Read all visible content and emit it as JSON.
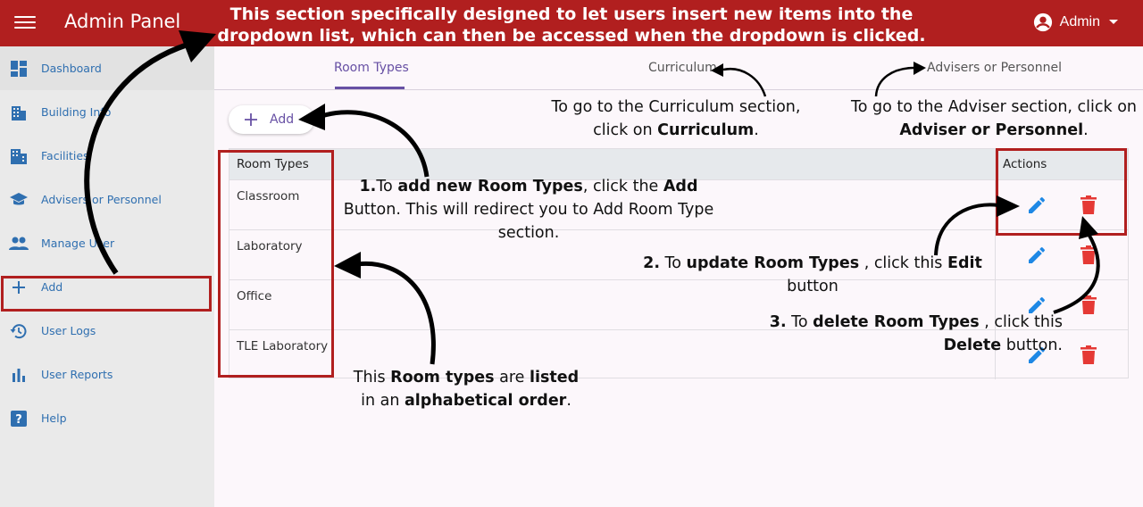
{
  "header": {
    "app_title": "Admin Panel",
    "banner": "This section specifically designed to let users insert new items into the dropdown list, which can then be accessed when the dropdown is clicked.",
    "user_name": "Admin"
  },
  "sidebar": {
    "items": [
      {
        "label": "Dashboard",
        "icon": "dashboard-icon"
      },
      {
        "label": "Building Info",
        "icon": "building-icon"
      },
      {
        "label": "Facilities",
        "icon": "facilities-icon"
      },
      {
        "label": "Advisers or Personnel",
        "icon": "school-icon"
      },
      {
        "label": "Manage User",
        "icon": "people-icon"
      },
      {
        "label": "Add",
        "icon": "plus-icon"
      },
      {
        "label": "User Logs",
        "icon": "history-icon"
      },
      {
        "label": "User Reports",
        "icon": "bar-chart-icon"
      },
      {
        "label": "Help",
        "icon": "help-icon"
      }
    ]
  },
  "tabs": [
    {
      "label": "Room Types",
      "active": true
    },
    {
      "label": "Curriculum",
      "active": false
    },
    {
      "label": "Advisers or Personnel",
      "active": false
    }
  ],
  "add_button": {
    "label": "Add"
  },
  "table": {
    "headers": {
      "name": "Room Types",
      "actions": "Actions"
    },
    "rows": [
      "Classroom",
      "Laboratory",
      "Office",
      "TLE Laboratory"
    ]
  },
  "annotations": {
    "curriculum_note": {
      "pre": "To go to the Curriculum section, click on ",
      "bold": "Curriculum",
      "post": "."
    },
    "adviser_note": {
      "pre": "To go to the Adviser section, click on ",
      "bold": "Adviser or Personnel",
      "post": "."
    },
    "add_note": {
      "num": "1.",
      "pre": "To ",
      "bold": "add new Room Types",
      "mid": ", click the ",
      "bold2": "Add",
      "post": " Button. This will redirect you to Add Room Type section."
    },
    "edit_note": {
      "num": "2.",
      "pre": " To ",
      "bold": "update Room Types",
      "mid": " , click this ",
      "bold2": "Edit",
      "post": " button"
    },
    "delete_note": {
      "num": "3.",
      "pre": " To ",
      "bold": "delete Room Types",
      "mid": " , click this ",
      "bold2": "Delete",
      "post": " button."
    },
    "list_note": {
      "pre": "This ",
      "bold": "Room types",
      "mid": " are ",
      "bold2": "listed",
      "mid2": " in an ",
      "bold3": "alphabetical order",
      "post": "."
    }
  },
  "colors": {
    "brand": "#b11f1f",
    "accent": "#6750a4",
    "edit": "#1e88e5",
    "delete": "#e53935",
    "link": "#2f6fb0"
  }
}
